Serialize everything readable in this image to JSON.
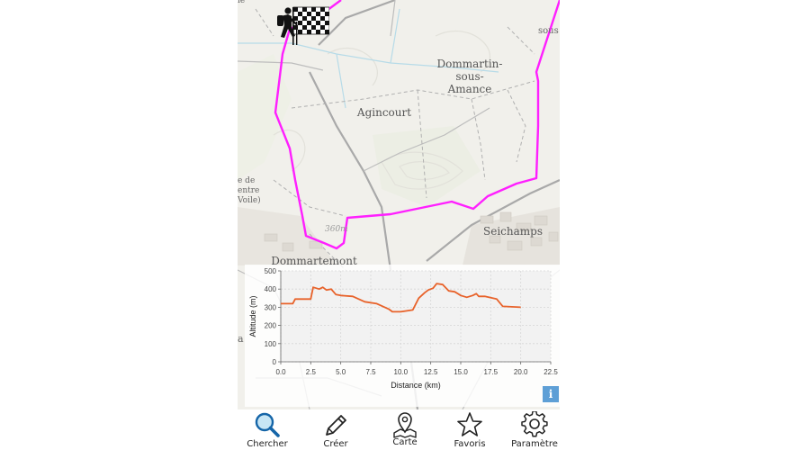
{
  "map": {
    "places": [
      {
        "id": "agincourt",
        "text": "Agincourt"
      },
      {
        "id": "dommartin",
        "text": "Dommartin-\nsous-\nAmance"
      },
      {
        "id": "seichamps",
        "text": "Seichamps"
      },
      {
        "id": "dommartemont",
        "text": "Dommartemont"
      }
    ],
    "edge_labels": {
      "top_left": "ie",
      "top_right": "sous",
      "left_1": "e de",
      "left_2": "entre",
      "left_3": "Voile)",
      "left_4": "a"
    },
    "elevation_label": "360m",
    "route_color": "#ff1fff",
    "marker_icon": "hiker-finish-flag-icon"
  },
  "chart_data": {
    "type": "line",
    "xlabel": "Distance (km)",
    "ylabel": "Altitude (m)",
    "xlim": [
      0,
      22.5
    ],
    "ylim": [
      0,
      500
    ],
    "xticks": [
      "0.0",
      "2.5",
      "5.0",
      "7.5",
      "10.0",
      "12.5",
      "15.0",
      "17.5",
      "20.0",
      "22.5"
    ],
    "yticks": [
      "0",
      "100",
      "200",
      "300",
      "400",
      "500"
    ],
    "grid": true,
    "series_color": "#e8622a",
    "x": [
      0,
      1,
      1.2,
      2.5,
      2.7,
      3.2,
      3.5,
      3.8,
      4.2,
      4.6,
      5,
      6,
      7,
      8,
      9,
      9.3,
      10,
      11,
      11.5,
      12,
      12.3,
      12.7,
      13,
      13.5,
      14,
      14.5,
      15,
      15.5,
      16,
      16.3,
      16.5,
      17,
      18,
      18.5,
      20
    ],
    "y": [
      320,
      320,
      345,
      345,
      410,
      400,
      410,
      395,
      400,
      370,
      365,
      360,
      330,
      320,
      290,
      275,
      275,
      285,
      350,
      380,
      395,
      405,
      430,
      425,
      390,
      385,
      365,
      355,
      365,
      375,
      360,
      360,
      345,
      305,
      300
    ]
  },
  "info_button": "i",
  "tabs": [
    {
      "label": "Chercher",
      "icon": "search-icon"
    },
    {
      "label": "Créer",
      "icon": "pencil-icon"
    },
    {
      "label": "Carte",
      "icon": "map-pin-icon"
    },
    {
      "label": "Favoris",
      "icon": "star-icon"
    },
    {
      "label": "Paramètre",
      "icon": "gear-icon"
    }
  ]
}
